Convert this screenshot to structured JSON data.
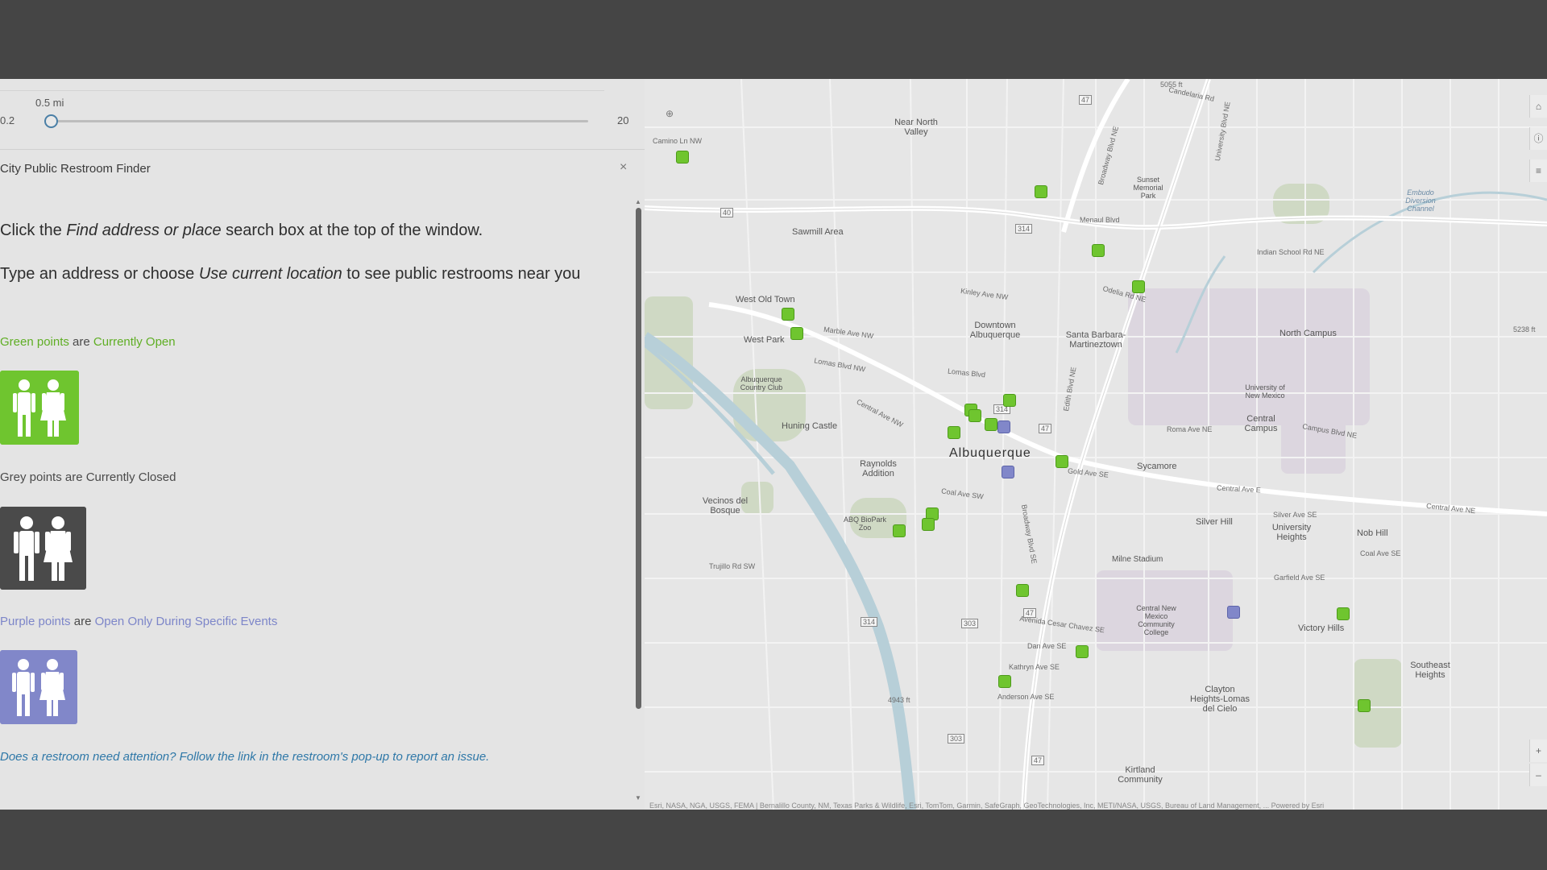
{
  "slider": {
    "value": "0.5 mi",
    "min": "0.2",
    "max": "20"
  },
  "widget": {
    "title": "City Public Restroom Finder",
    "close": "×"
  },
  "instructions": {
    "p1_a": "Click the ",
    "p1_em": "Find address or place",
    "p1_b": " search box at the top of the window.",
    "p2_a": "Type an address or choose ",
    "p2_em": "Use current location",
    "p2_b": " to see public restrooms near you"
  },
  "legend": {
    "green_a": "Green points",
    "green_b": " are ",
    "green_c": "Currently Open",
    "grey": "Grey points are Currently Closed",
    "purple_a": "Purple points",
    "purple_b": " are ",
    "purple_c": "Open Only During Specific Events"
  },
  "attention": "Does a restroom need attention? Follow the link in the restroom's pop-up to report an issue.",
  "map": {
    "labels": [
      {
        "text": "Near North Valley"
      },
      {
        "text": "Sawmill Area"
      },
      {
        "text": "West Old Town"
      },
      {
        "text": "West Park"
      },
      {
        "text": "Downtown Albuquerque"
      },
      {
        "text": "Santa Barbara-Martineztown"
      },
      {
        "text": "Sunset Memorial Park"
      },
      {
        "text": "North Campus"
      },
      {
        "text": "University of New Mexico"
      },
      {
        "text": "Central Campus"
      },
      {
        "text": "Huning Castle"
      },
      {
        "text": "Albuquerque Country Club"
      },
      {
        "text": "Raynolds Addition"
      },
      {
        "text": "Albuquerque"
      },
      {
        "text": "Sycamore"
      },
      {
        "text": "Vecinos del Bosque"
      },
      {
        "text": "ABQ BioPark Zoo"
      },
      {
        "text": "Silver Hill"
      },
      {
        "text": "University Heights"
      },
      {
        "text": "Nob Hill"
      },
      {
        "text": "Milne Stadium"
      },
      {
        "text": "Central New Mexico Community College"
      },
      {
        "text": "Victory Hills"
      },
      {
        "text": "Southeast Heights"
      },
      {
        "text": "Clayton Heights-Lomas del Cielo"
      },
      {
        "text": "Kirtland Community"
      },
      {
        "text": "Embudo Diversion Channel"
      }
    ],
    "streets": [
      {
        "text": "Candelaria Rd"
      },
      {
        "text": "Central Ave NW"
      },
      {
        "text": "Central Ave E"
      },
      {
        "text": "Central Ave NE"
      },
      {
        "text": "Lomas Blvd NW"
      },
      {
        "text": "Lomas Blvd"
      },
      {
        "text": "Marble Ave NW"
      },
      {
        "text": "Kinley Ave NW"
      },
      {
        "text": "Coal Ave SW"
      },
      {
        "text": "Gold Ave SE"
      },
      {
        "text": "Indian School Rd NE"
      },
      {
        "text": "Trujillo Rd SW"
      },
      {
        "text": "Avenida Cesar Chavez SE"
      },
      {
        "text": "Kathryn Ave SE"
      },
      {
        "text": "Anderson Ave SE"
      },
      {
        "text": "Dan Ave SE"
      },
      {
        "text": "Garfield Ave SE"
      },
      {
        "text": "Silver Ave SE"
      },
      {
        "text": "Coal Ave SE"
      },
      {
        "text": "Roma Ave NE"
      },
      {
        "text": "Campus Blvd NE"
      },
      {
        "text": "Odelia Rd NE"
      },
      {
        "text": "Camino Ln NW"
      },
      {
        "text": "Menaul Blvd"
      },
      {
        "text": "Broadway Blvd NE"
      },
      {
        "text": "Broadway Blvd SE"
      },
      {
        "text": "Edith Blvd NE"
      },
      {
        "text": "University Blvd NE"
      }
    ],
    "shields": [
      "47",
      "314",
      "47",
      "314",
      "47",
      "303",
      "314",
      "47",
      "303",
      "40"
    ],
    "elevations": [
      "5055 ft",
      "4943 ft",
      "5238 ft"
    ],
    "controls": {
      "zoom_in": "+",
      "zoom_out": "–"
    },
    "attribution": "Esri, NASA, NGA, USGS, FEMA | Bernalillo County, NM, Texas Parks & Wildlife, Esri, TomTom, Garmin, SafeGraph, GeoTechnologies, Inc, METI/NASA, USGS, Bureau of Land Management, ...  Powered by Esri",
    "colors": {
      "open": "#6fc52f",
      "closed": "#4a4a4a",
      "events": "#8187c9"
    }
  }
}
